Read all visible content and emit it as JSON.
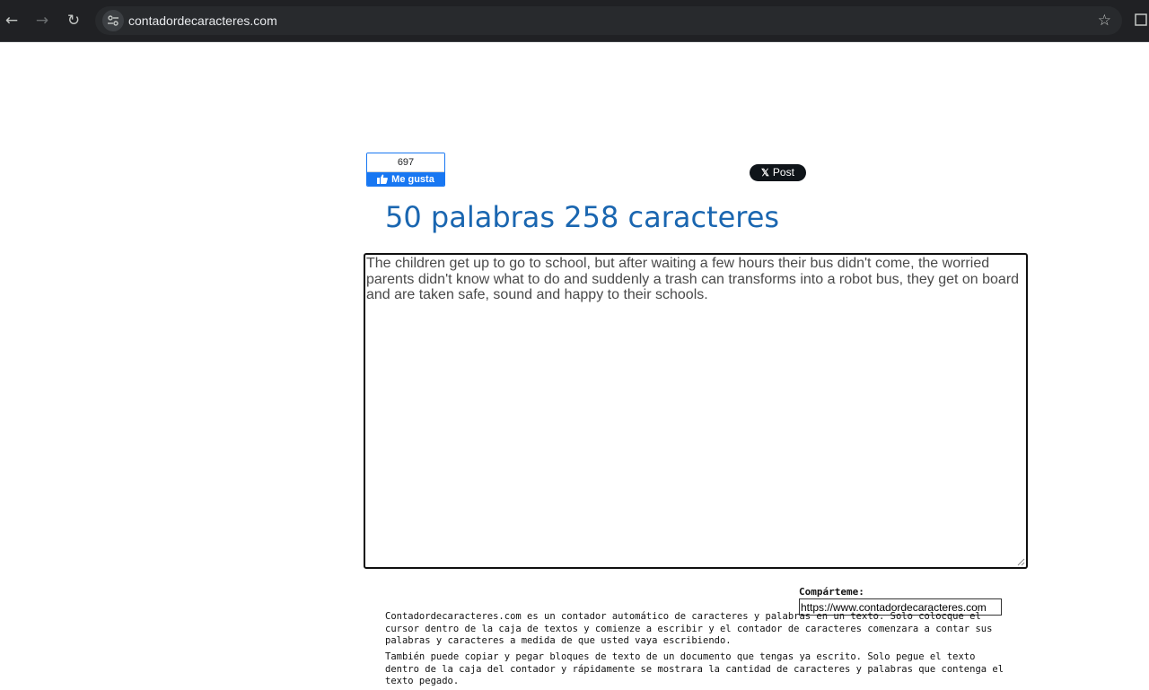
{
  "browser": {
    "url": "contadordecaracteres.com",
    "icons": {
      "back": "back-arrow-icon",
      "forward": "forward-arrow-icon",
      "reload": "reload-icon",
      "site_settings": "tune-icon",
      "bookmark": "star-icon",
      "extensions": "extension-icon"
    }
  },
  "social": {
    "fb_count": "697",
    "fb_label": "Me gusta",
    "x_label": "Post"
  },
  "counter": {
    "title": "50 palabras 258 caracteres",
    "text": "The children get up to go to school, but after waiting a few hours their bus didn't come, the worried parents didn't know what to do and suddenly a trash can transforms into a robot bus, they get on board and are taken safe, sound and happy to their schools."
  },
  "share": {
    "label": "Compárteme:",
    "url": "https://www.contadordecaracteres.com"
  },
  "description": {
    "paragraph_1": "Contadordecaracteres.com es un contador automático de caracteres y palabras en un texto. Solo colocque el cursor dentro de la caja de textos y comienze a escribir y el contador de caracteres comenzara a contar sus palabras y caracteres a medida de que usted vaya escribiendo.",
    "paragraph_2": "También puede copiar y pegar bloques de texto de un documento que tengas ya escrito. Solo pegue el texto dentro de la caja del contador y rápidamente se mostrara la cantidad de caracteres y palabras que contenga el texto pegado."
  },
  "colors": {
    "title_blue": "#1a66b0",
    "facebook_blue": "#1877f2",
    "chrome_dark": "#202124"
  }
}
